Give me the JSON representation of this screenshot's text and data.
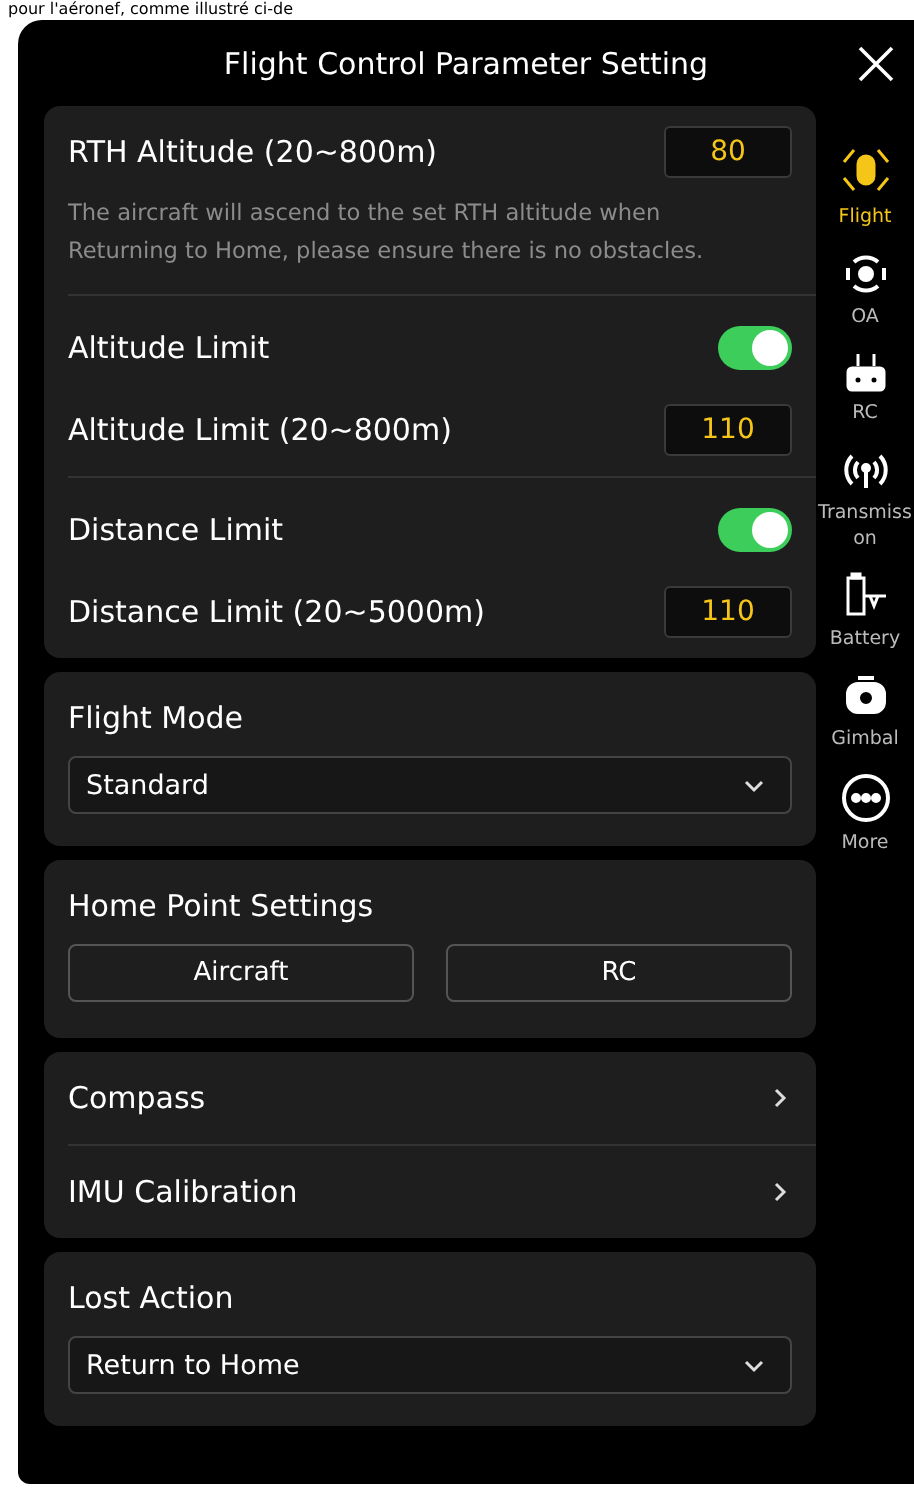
{
  "caption": "pour l'aéronef, comme illustré ci-de",
  "window": {
    "title": "Flight Control Parameter Setting"
  },
  "sections": [
    {
      "groups": [
        [
          {
            "kind": "input",
            "label": "RTH Altitude (20~800m)",
            "value": "80"
          },
          {
            "kind": "note",
            "text": "The aircraft will ascend to the set RTH altitude when Returning to Home, please ensure there is no obstacles."
          }
        ],
        [
          {
            "kind": "toggle",
            "label": "Altitude Limit",
            "on": true
          },
          {
            "kind": "input",
            "label": "Altitude Limit (20~800m)",
            "value": "110"
          }
        ],
        [
          {
            "kind": "toggle",
            "label": "Distance Limit",
            "on": true
          },
          {
            "kind": "input",
            "label": "Distance Limit (20~5000m)",
            "value": "110"
          }
        ]
      ]
    },
    {
      "groups": [
        [
          {
            "kind": "heading",
            "label": "Flight Mode"
          },
          {
            "kind": "select",
            "value": "Standard"
          }
        ]
      ]
    },
    {
      "groups": [
        [
          {
            "kind": "heading",
            "label": "Home Point Settings"
          },
          {
            "kind": "buttons",
            "buttons": [
              "Aircraft",
              "RC"
            ]
          }
        ]
      ]
    },
    {
      "groups": [
        [
          {
            "kind": "link",
            "label": "Compass"
          }
        ],
        [
          {
            "kind": "link",
            "label": "IMU Calibration"
          }
        ]
      ]
    },
    {
      "groups": [
        [
          {
            "kind": "heading",
            "label": "Lost Action"
          },
          {
            "kind": "select",
            "value": "Return to Home"
          }
        ]
      ]
    }
  ],
  "sidebar": [
    {
      "label": "Flight",
      "selected": true
    },
    {
      "label": "OA",
      "selected": false
    },
    {
      "label": "RC",
      "selected": false
    },
    {
      "label": "Transmiss on",
      "selected": false
    },
    {
      "label": "Battery",
      "selected": false
    },
    {
      "label": "Gimbal",
      "selected": false
    },
    {
      "label": "More",
      "selected": false
    }
  ]
}
